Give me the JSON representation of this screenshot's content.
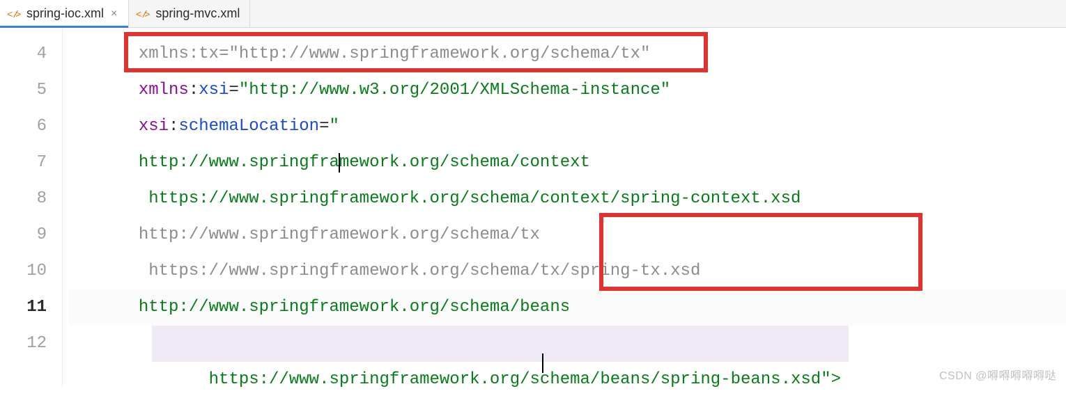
{
  "tabs": [
    {
      "label": "spring-ioc.xml",
      "active": true,
      "closeGlyph": "×"
    },
    {
      "label": "spring-mvc.xml",
      "active": false,
      "closeGlyph": ""
    }
  ],
  "gutter": {
    "numbers": [
      "4",
      "5",
      "6",
      "7",
      "8",
      "9",
      "10",
      "11",
      "12"
    ],
    "currentIndex": 7
  },
  "code": {
    "l4": {
      "ns": "xmlns",
      "attr": "tx",
      "val": "\"http://www.springframework.org/schema/tx\""
    },
    "l5": {
      "ns": "xmlns",
      "attr": "xsi",
      "val": "\"http://www.w3.org/2001/XMLSchema-instance\""
    },
    "l6": {
      "ns": "xsi",
      "attr": "schemaLocation",
      "q": "\""
    },
    "l7": {
      "url": "http://www.springframework.org/schema/context"
    },
    "l8": {
      "url": "https://www.springframework.org/schema/context/spring-context.xsd"
    },
    "l9": {
      "url": "http://www.springframework.org/schema/tx"
    },
    "l10": {
      "url": "https://www.springframework.org/schema/tx/spring-tx.xsd"
    },
    "l11": {
      "url": "http://www.springframework.org/schema/beans"
    },
    "l12": {
      "url": "https://www.springframework.org/schema/beans/spring-beans.xsd",
      "tail": "\">"
    }
  },
  "watermark": "CSDN @嘚嘚嘚嘚嘚哒"
}
